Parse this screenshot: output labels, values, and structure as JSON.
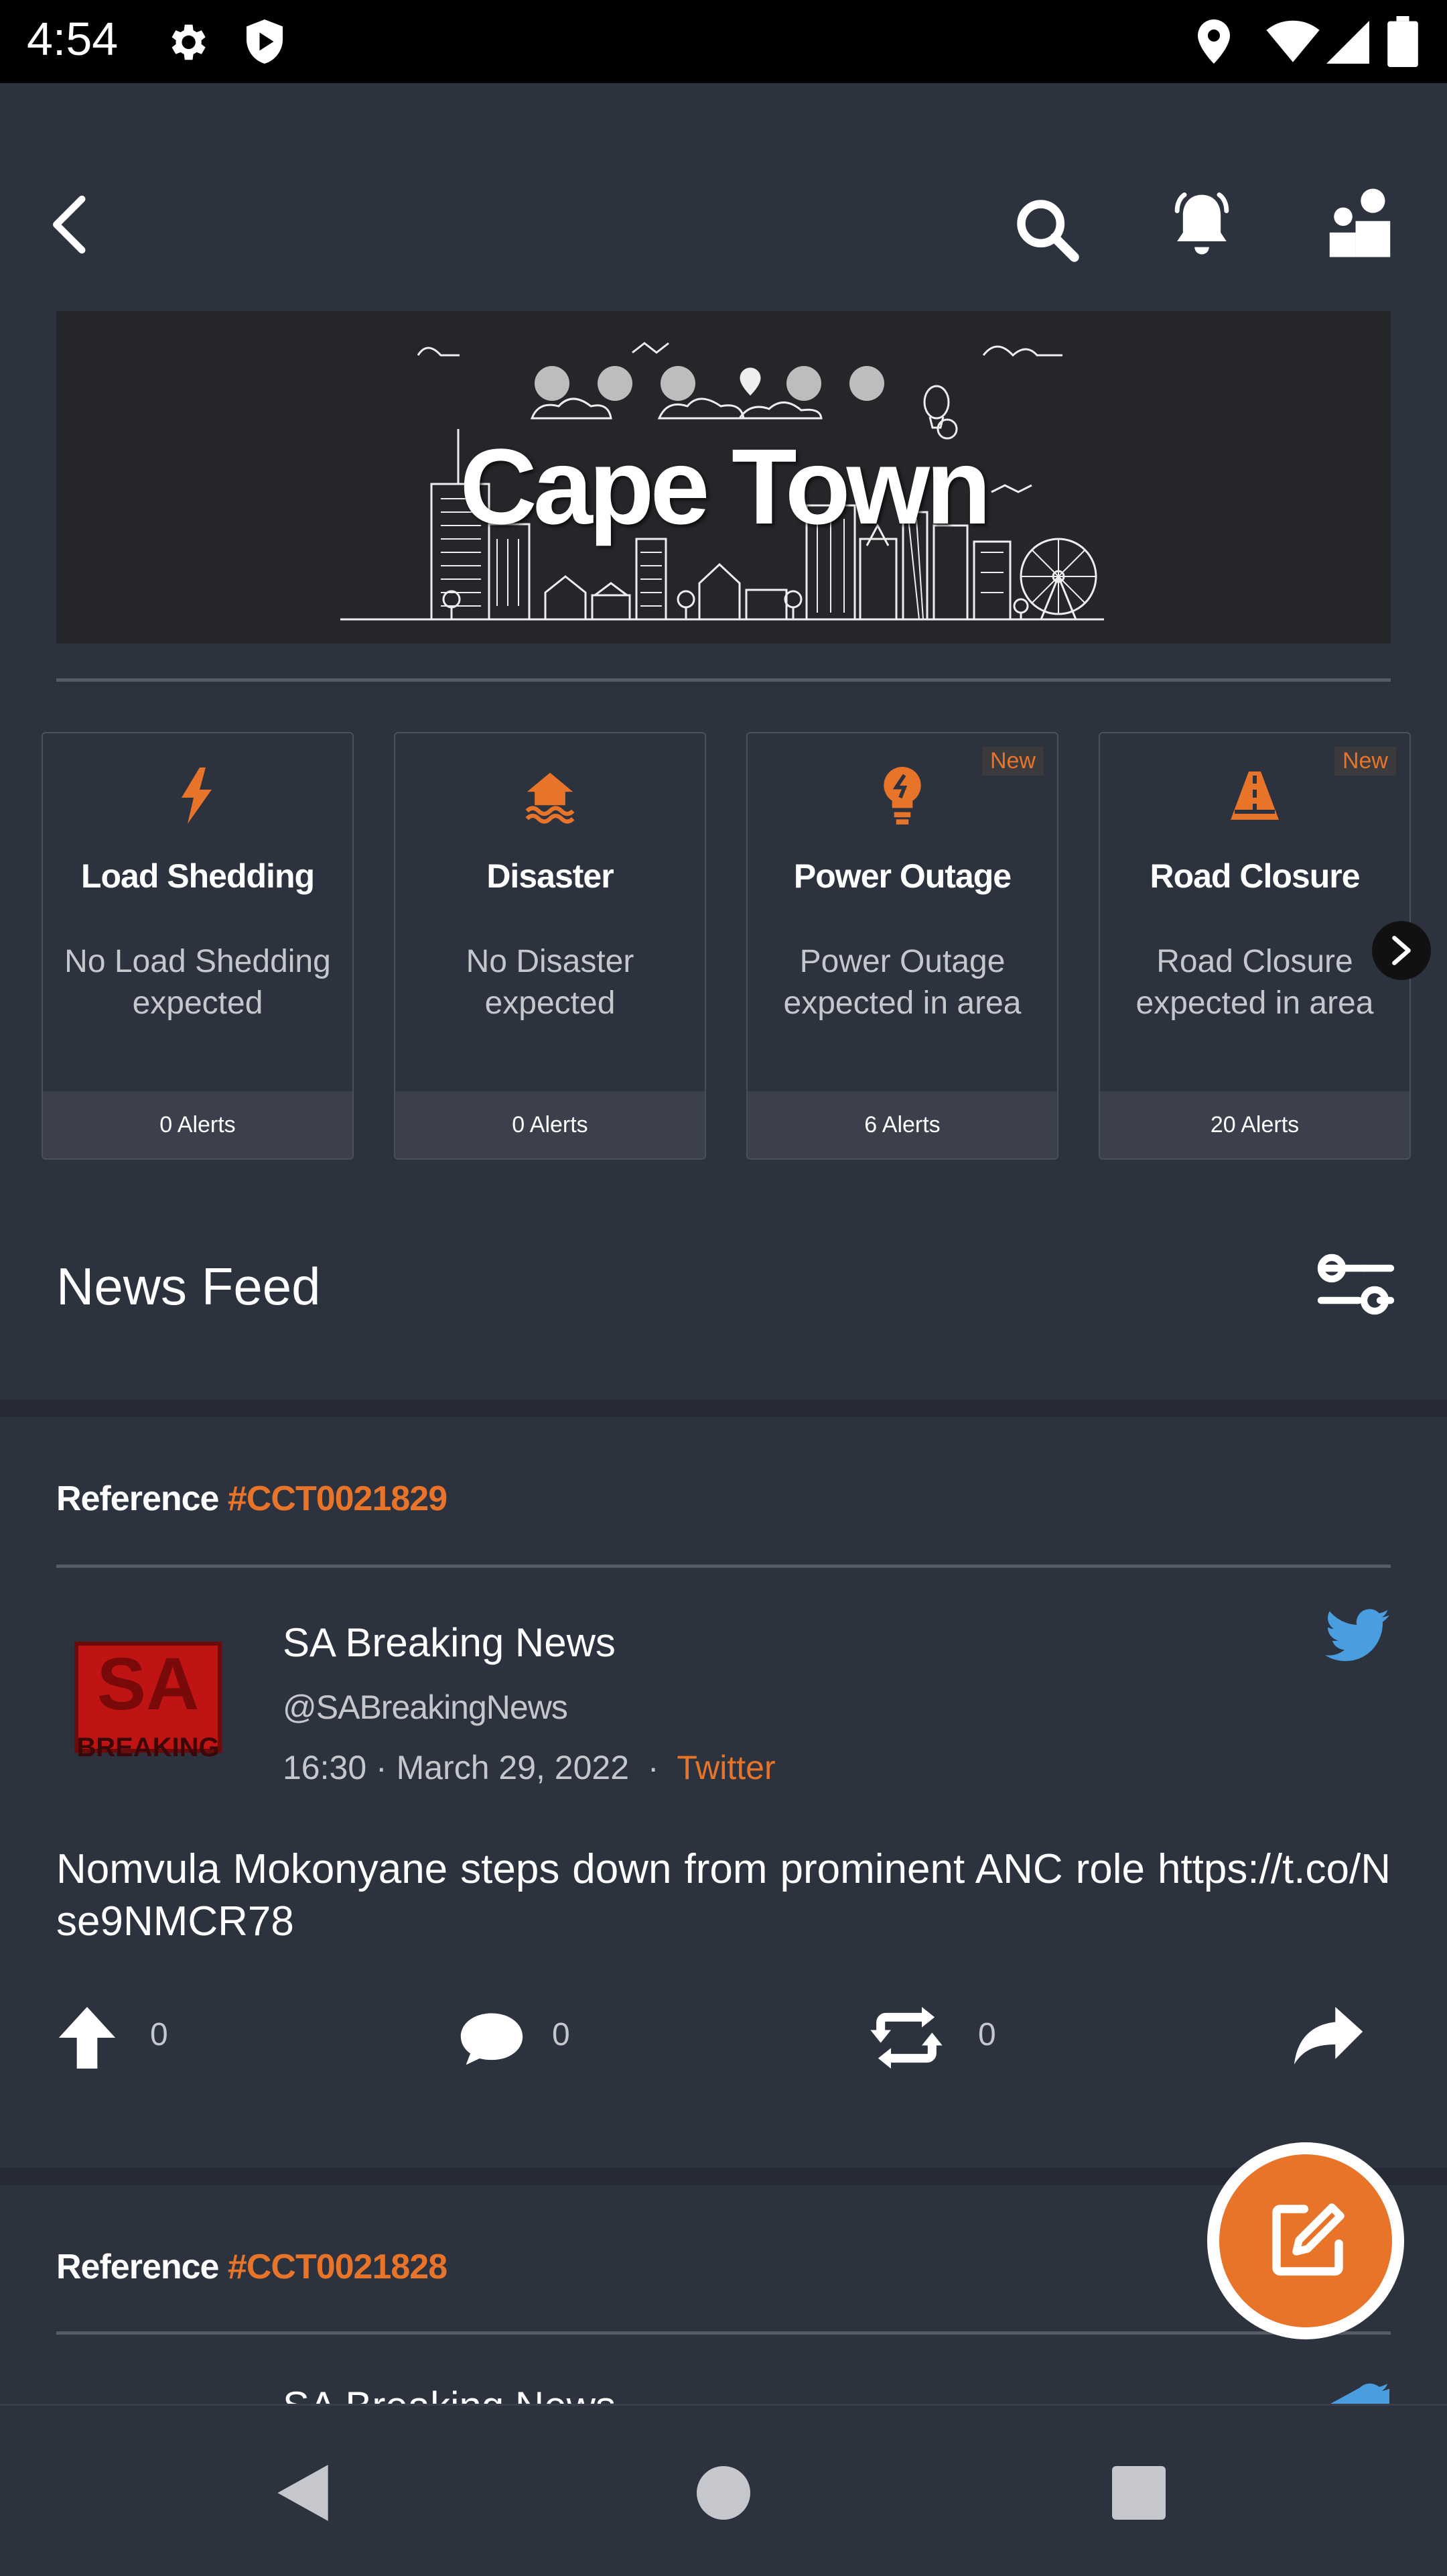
{
  "status_bar": {
    "time": "4:54"
  },
  "banner": {
    "city": "Cape Town"
  },
  "alert_cards": [
    {
      "title": "Load Shedding",
      "description": "No Load Shedding expected",
      "alerts": "0 Alerts",
      "badge": "",
      "icon": "lightning-icon"
    },
    {
      "title": "Disaster",
      "description": "No Disaster expected",
      "alerts": "0 Alerts",
      "badge": "",
      "icon": "flood-house-icon"
    },
    {
      "title": "Power Outage",
      "description": "Power Outage expected in area",
      "alerts": "6 Alerts",
      "badge": "New",
      "icon": "bulb-icon"
    },
    {
      "title": "Road Closure",
      "description": "Road Closure expected in area",
      "alerts": "20 Alerts",
      "badge": "New",
      "icon": "road-closure-icon"
    }
  ],
  "news_feed": {
    "title": "News Feed"
  },
  "posts": [
    {
      "reference_label": "Reference",
      "reference_id": "#CCT0021829",
      "author": "SA Breaking News",
      "handle": "@SABreakingNews",
      "time": "16:30",
      "date": "March 29, 2022",
      "source": "Twitter",
      "text": "Nomvula Mokonyane steps down from prominent ANC role https://t.co/Nse9NMCR78",
      "upvotes": "0",
      "comments": "0",
      "retweets": "0"
    },
    {
      "reference_label": "Reference",
      "reference_id": "#CCT0021828",
      "author": "SA Breaking News"
    }
  ],
  "colors": {
    "accent": "#e8742a",
    "background": "#2d323f",
    "twitter": "#4a9ee0"
  }
}
